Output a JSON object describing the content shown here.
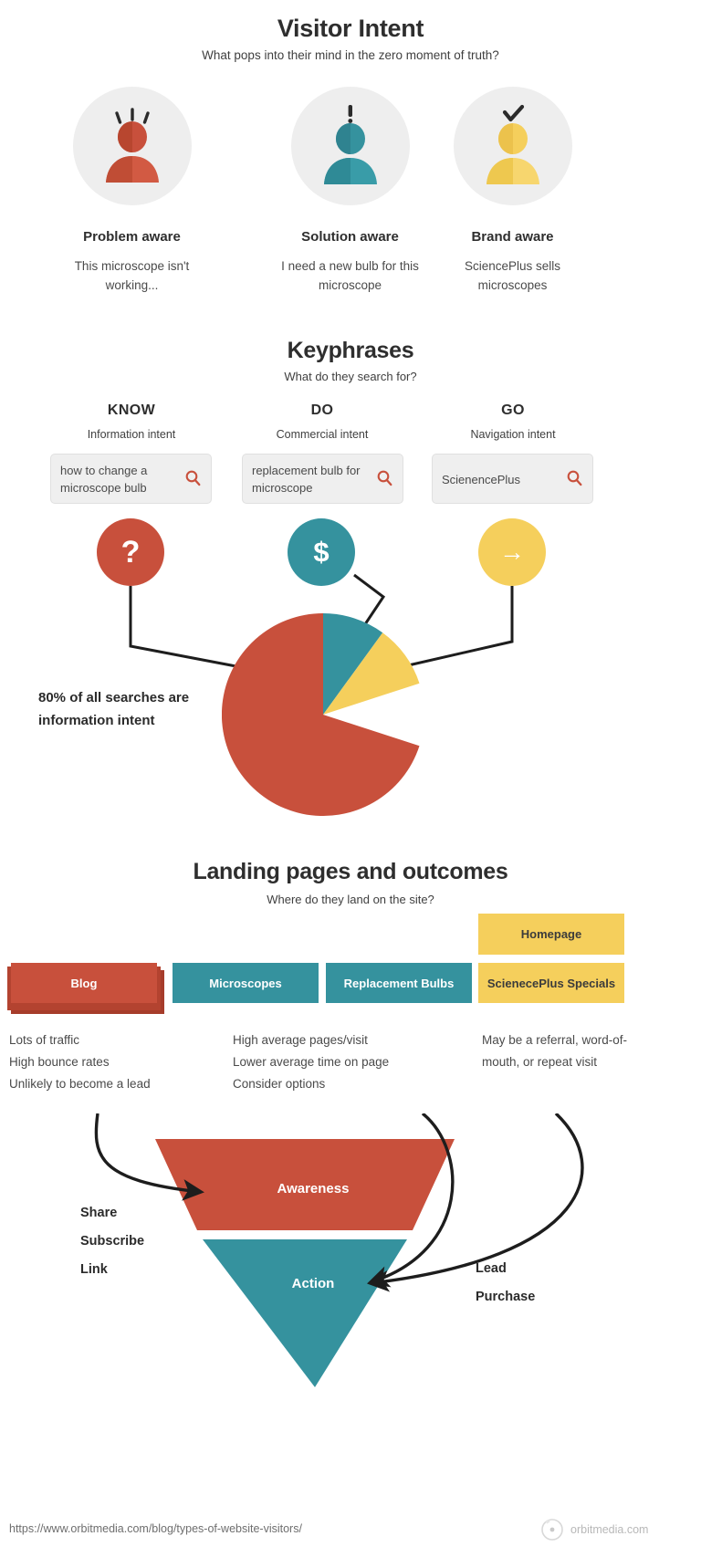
{
  "sections": {
    "visitor_intent": {
      "title": "Visitor Intent",
      "subtitle": "What pops into their mind in the zero moment of truth?",
      "personas": [
        {
          "name": "Problem aware",
          "desc": "This microscope isn't working...",
          "color": "#c8503c",
          "icon": "person-surprised-icon",
          "mark": "lines"
        },
        {
          "name": "Solution aware",
          "desc": "I need a new bulb for this microscope",
          "color": "#35929e",
          "icon": "person-exclamation-icon",
          "mark": "!"
        },
        {
          "name": "Brand aware",
          "desc": "SciencePlus sells microscopes",
          "color": "#f5cf5c",
          "icon": "person-check-icon",
          "mark": "✔"
        }
      ]
    },
    "keyphrases": {
      "title": "Keyphrases",
      "subtitle": "What do they search for?",
      "columns": [
        {
          "word": "KNOW",
          "intent": "Information intent",
          "query": "how to change a microscope bulb",
          "badge_glyph": "?",
          "badge_color": "#c8503c"
        },
        {
          "word": "DO",
          "intent": "Commercial intent",
          "query": "replacement bulb for microscope",
          "badge_glyph": "$",
          "badge_color": "#35929e"
        },
        {
          "word": "GO",
          "intent": "Navigation intent",
          "query": "ScienencePlus",
          "badge_glyph": "→",
          "badge_color": "#f5cf5c"
        }
      ],
      "pie_note": "80% of all searches are information intent"
    },
    "landing_pages": {
      "title": "Landing pages and outcomes",
      "subtitle": "Where do they land on the site?",
      "tabs": [
        {
          "label": "Homepage",
          "color": "#f5cf5c"
        },
        {
          "label": "Blog",
          "color": "#c8503c"
        },
        {
          "label": "Microscopes",
          "color": "#35929e"
        },
        {
          "label": "Replacement Bulbs",
          "color": "#35929e"
        },
        {
          "label": "ScienecePlus Specials",
          "color": "#f5cf5c"
        }
      ],
      "notes": [
        {
          "lines": "Lots of traffic\nHigh bounce rates\nUnlikely to become a lead"
        },
        {
          "lines": "High average pages/visit\nLower average time on page\nConsider options"
        },
        {
          "lines": "May be a referral, word-of-mouth, or repeat visit"
        }
      ],
      "funnel": {
        "top_label": "Awareness",
        "bottom_label": "Action",
        "top_color": "#c8503c",
        "bottom_color": "#35929e",
        "left_words": "Share\nSubscribe\nLink",
        "right_words": "Lead\nPurchase"
      }
    }
  },
  "chart_data": {
    "type": "pie",
    "title": "Share of searches by intent",
    "categories": [
      "Information intent (KNOW)",
      "Commercial intent (DO)",
      "Navigation intent (GO)"
    ],
    "values": [
      80,
      10,
      10
    ],
    "colors": [
      "#c8503c",
      "#35929e",
      "#f5cf5c"
    ],
    "annotation": "80% of all searches are information intent",
    "legend": "none",
    "grid": false
  },
  "footer": {
    "url": "https://www.orbitmedia.com/blog/types-of-website-visitors/",
    "logo_text": "orbitmedia.com"
  }
}
